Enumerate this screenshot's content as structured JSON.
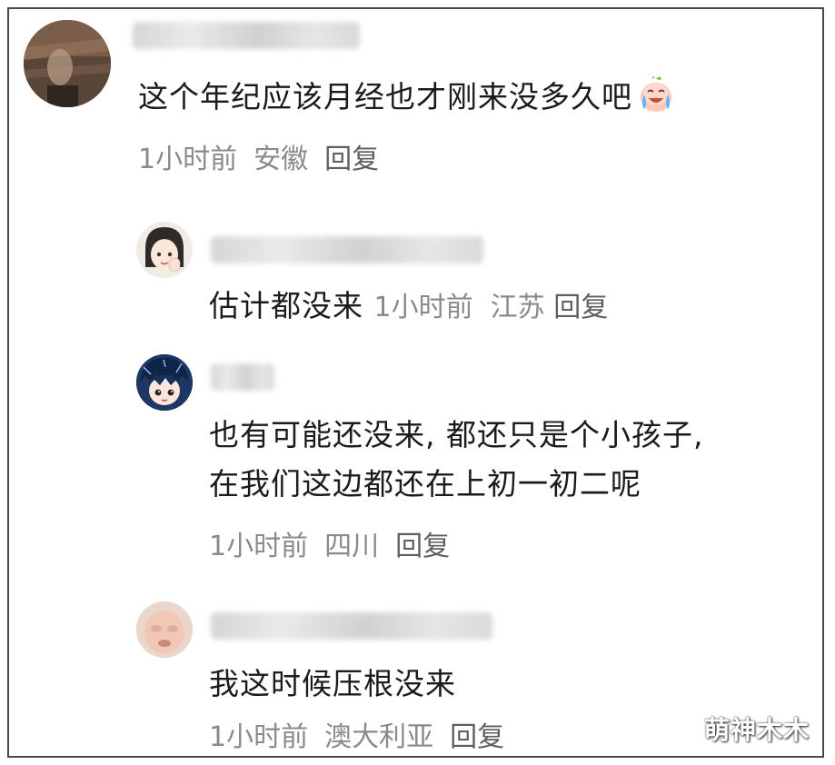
{
  "comments": [
    {
      "text": "这个年纪应该月经也才刚来没多久吧",
      "emoji": "crying-laughing-peach-emoji",
      "time": "1小时前",
      "location": "安徽",
      "reply": "回复"
    },
    {
      "text": "估计都没来",
      "time": "1小时前",
      "location": "江苏",
      "reply": "回复"
    },
    {
      "text_line1": "也有可能还没来, 都还只是个小孩子,",
      "text_line2": "在我们这边都还在上初一初二呢",
      "time": "1小时前",
      "location": "四川",
      "reply": "回复"
    },
    {
      "text": "我这时候压根没来",
      "time": "1小时前",
      "location": "澳大利亚",
      "reply": "回复"
    }
  ],
  "watermark": "萌神木木",
  "colors": {
    "text": "#1b1b1b",
    "meta": "#8a8a8a",
    "border": "#4a4a4a"
  }
}
